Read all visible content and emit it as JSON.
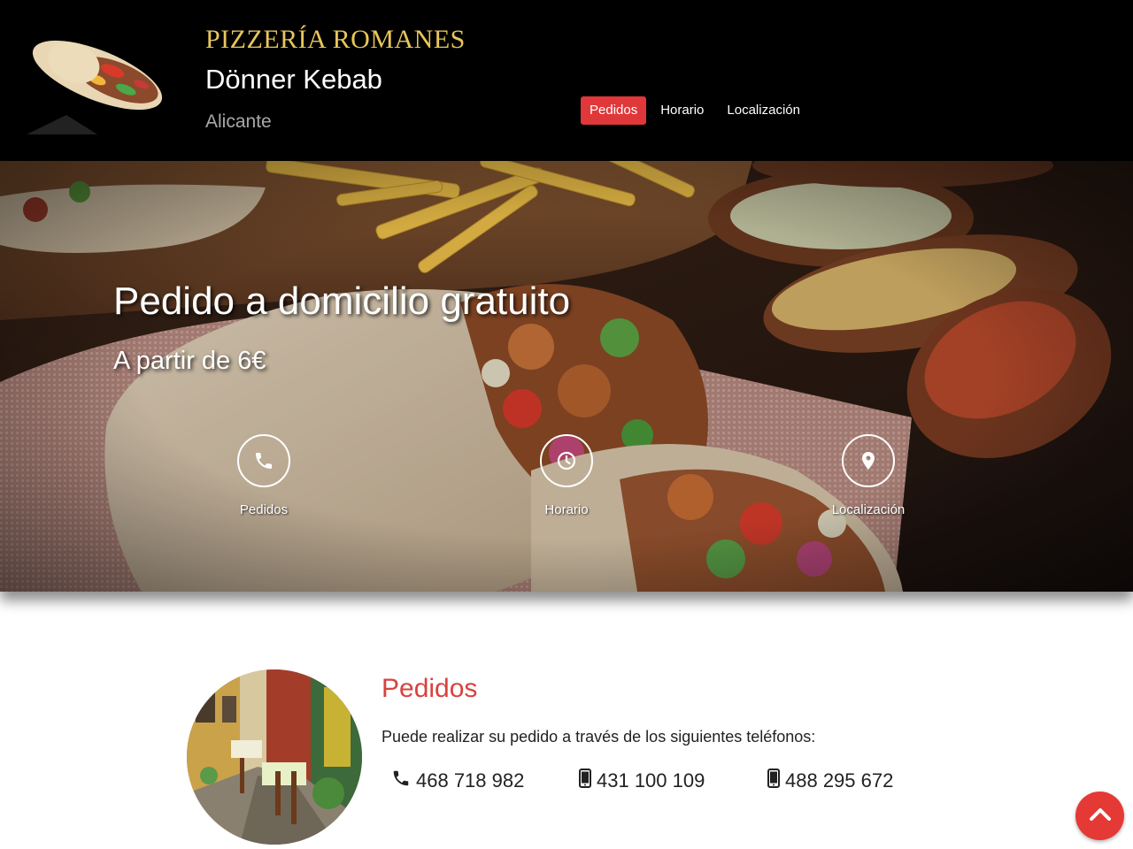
{
  "header": {
    "brand_title": "PIZZERÍA ROMANES",
    "brand_subtitle": "Dönner Kebab",
    "city": "Alicante",
    "nav": [
      {
        "label": "Pedidos",
        "active": true
      },
      {
        "label": "Horario",
        "active": false
      },
      {
        "label": "Localización",
        "active": false
      }
    ]
  },
  "hero": {
    "title": "Pedido a domicilio gratuito",
    "subtitle": "A partir de 6€",
    "buttons": [
      {
        "label": "Pedidos",
        "icon": "phone-icon"
      },
      {
        "label": "Horario",
        "icon": "clock-icon"
      },
      {
        "label": "Localización",
        "icon": "map-pin-icon"
      }
    ]
  },
  "orders": {
    "title": "Pedidos",
    "text": "Puede realizar su pedido a través de los siguientes teléfonos:",
    "phones": [
      {
        "number": "468 718 982",
        "icon": "phone-icon"
      },
      {
        "number": "431 100 109",
        "icon": "mobile-icon"
      },
      {
        "number": "488 295 672",
        "icon": "mobile-icon"
      }
    ]
  },
  "colors": {
    "accent": "#e0373a",
    "brand_gold": "#e8c65a",
    "section_title": "#d9423d"
  }
}
